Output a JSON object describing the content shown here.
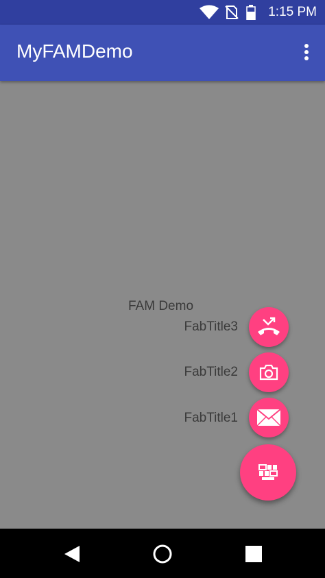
{
  "status_bar": {
    "time": "1:15 PM",
    "icons": [
      "wifi-icon",
      "no-sim-icon",
      "battery-icon"
    ]
  },
  "app_bar": {
    "title": "MyFAMDemo",
    "overflow_icon": "more-vert-icon"
  },
  "fam": {
    "label": "FAM Demo",
    "items": [
      {
        "title": "FabTitle3",
        "icon": "call-missed-icon"
      },
      {
        "title": "FabTitle2",
        "icon": "camera-icon"
      },
      {
        "title": "FabTitle1",
        "icon": "email-icon"
      }
    ],
    "main_icon": "grid-menu-icon"
  },
  "nav_bar": {
    "icons": [
      "back-icon",
      "home-icon",
      "recents-icon"
    ]
  },
  "colors": {
    "status_bar": "#303f9f",
    "app_bar": "#3f51b5",
    "accent": "#ff4081",
    "scrim": "#8a8a8a"
  }
}
